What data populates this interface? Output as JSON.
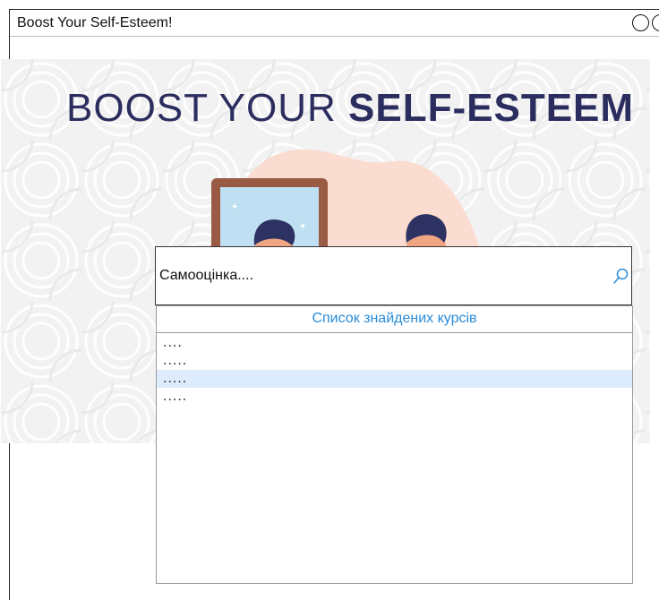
{
  "window": {
    "title": "Boost Your Self-Esteem!"
  },
  "banner": {
    "headline_light": "BOOST YOUR ",
    "headline_bold": "SELF-ESTEEM",
    "colors": {
      "headline": "#2b2d5e",
      "blob": "#fbdcd0",
      "mirror_frame": "#9a5b45",
      "mirror_glass": "#bfe0f2",
      "shirt": "#e8553d",
      "hair": "#2d3263",
      "skin": "#f0a582"
    }
  },
  "search": {
    "value": "Самооцінка....",
    "icon": "search-icon"
  },
  "results": {
    "header": "Список знайдених курсів",
    "items": [
      {
        "label": "....",
        "selected": false
      },
      {
        "label": ".....",
        "selected": false
      },
      {
        "label": ".....",
        "selected": true
      },
      {
        "label": ".....",
        "selected": false
      }
    ],
    "accent_color": "#2a8bd8",
    "selected_color": "#dcecfc"
  }
}
